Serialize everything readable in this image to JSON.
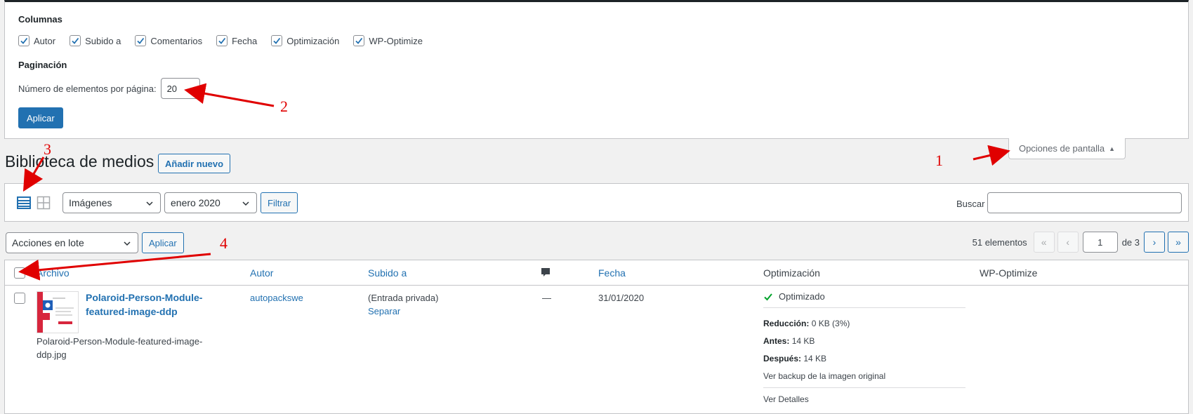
{
  "screen_options": {
    "columns_heading": "Columnas",
    "columns": [
      {
        "label": "Autor",
        "checked": true
      },
      {
        "label": "Subido a",
        "checked": true
      },
      {
        "label": "Comentarios",
        "checked": true
      },
      {
        "label": "Fecha",
        "checked": true
      },
      {
        "label": "Optimización",
        "checked": true
      },
      {
        "label": "WP-Optimize",
        "checked": true
      }
    ],
    "pagination_heading": "Paginación",
    "per_page_label": "Número de elementos por página:",
    "per_page_value": "20",
    "apply_label": "Aplicar",
    "tab_label": "Opciones de pantalla"
  },
  "page": {
    "title": "Biblioteca de medios",
    "add_new_label": "Añadir nuevo"
  },
  "filters": {
    "type_selected": "Imágenes",
    "date_selected": "enero 2020",
    "filter_label": "Filtrar",
    "search_label": "Buscar",
    "search_value": ""
  },
  "bulk": {
    "selected": "Acciones en lote",
    "apply_label": "Aplicar"
  },
  "pagination": {
    "count": "51 elementos",
    "first": "«",
    "prev": "‹",
    "current": "1",
    "of": "de 3",
    "next": "›",
    "last": "»"
  },
  "table": {
    "headers": {
      "file": "Archivo",
      "author": "Autor",
      "uploaded_to": "Subido a",
      "date": "Fecha",
      "optimization": "Optimización",
      "wp_optimize": "WP-Optimize"
    },
    "rows": [
      {
        "title": "Polaroid-Person-Module-featured-image-ddp",
        "filename": "Polaroid-Person-Module-featured-image-ddp.jpg",
        "author": "autopackswe",
        "uploaded_to": "(Entrada privada)",
        "detach": "Separar",
        "comments": "—",
        "date": "31/01/2020",
        "optimized": "Optimizado",
        "reduction_label": "Reducción:",
        "reduction_value": "0 KB (3%)",
        "before_label": "Antes:",
        "before_value": "14 KB",
        "after_label": "Después:",
        "after_value": "14 KB",
        "backup_link": "Ver backup de la imagen original",
        "details_link": "Ver Detalles"
      }
    ]
  },
  "annotations": [
    "1",
    "2",
    "3",
    "4"
  ],
  "colors": {
    "accent": "#2271b1",
    "annotation": "#e00000",
    "success": "#00a32a"
  }
}
